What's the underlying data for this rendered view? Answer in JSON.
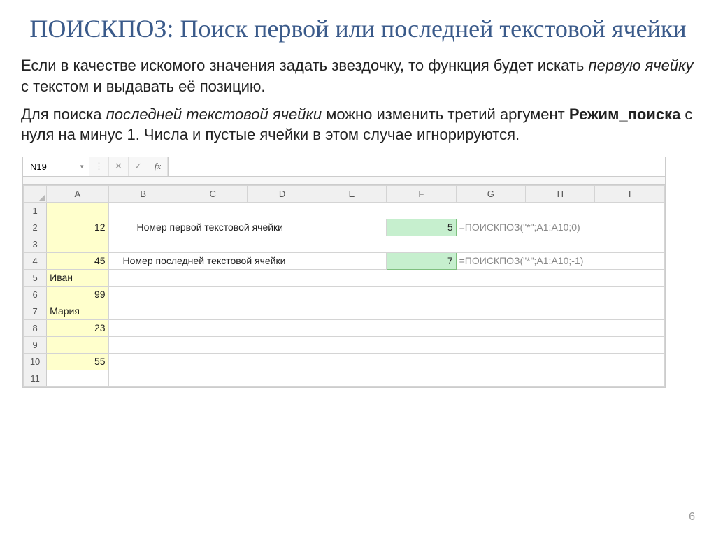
{
  "title": "ПОИСКПОЗ: Поиск первой или последней текстовой ячейки",
  "para1_a": "Если в качестве искомого значения задать звездочку, то функция будет искать ",
  "para1_b": "первую ячейку",
  "para1_c": " с текстом и выдавать её позицию.",
  "para2_a": "Для поиска ",
  "para2_b": "последней текстовой ячейки",
  "para2_c": " можно изменить третий аргумент ",
  "para2_d": "Режим_поиска",
  "para2_e": " с нуля на минус 1. Числа и пустые ячейки в этом случае игнорируются.",
  "excel": {
    "namebox": "N19",
    "columns": [
      "A",
      "B",
      "C",
      "D",
      "E",
      "F",
      "G",
      "H",
      "I"
    ],
    "row_numbers": [
      "1",
      "2",
      "3",
      "4",
      "5",
      "6",
      "7",
      "8",
      "9",
      "10",
      "11"
    ],
    "colA": {
      "r2": "12",
      "r4": "45",
      "r5": "Иван",
      "r6": "99",
      "r7": "Мария",
      "r8": "23",
      "r10": "55"
    },
    "label1": "Номер первой текстовой ячейки",
    "label2": "Номер последней текстовой ячейки",
    "result1": "5",
    "result2": "7",
    "formula1": "=ПОИСКПОЗ(\"*\";A1:A10;0)",
    "formula2": "=ПОИСКПОЗ(\"*\";A1:A10;-1)"
  },
  "page_number": "6"
}
